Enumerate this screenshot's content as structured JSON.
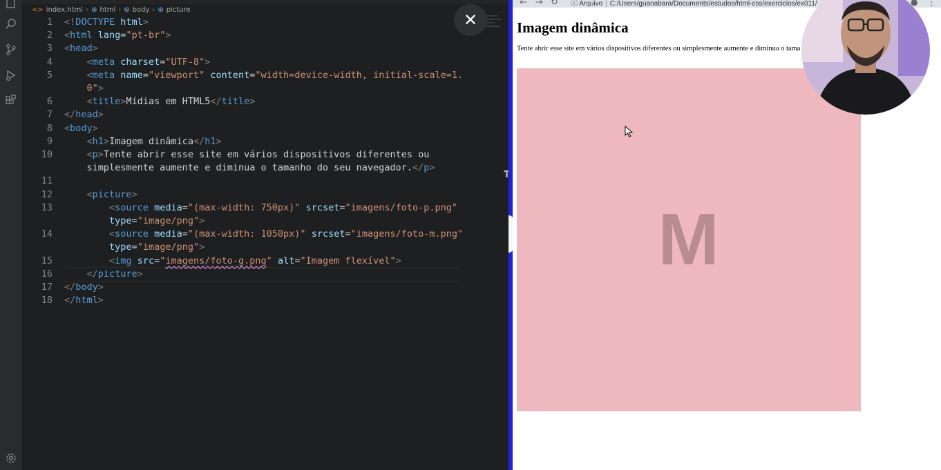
{
  "editor": {
    "breadcrumb": [
      "index.html",
      "html",
      "body",
      "picture"
    ],
    "lines": [
      {
        "n": "1",
        "parts": [
          [
            "br",
            "<!"
          ],
          [
            "tag",
            "DOCTYPE "
          ],
          [
            "at",
            "html"
          ],
          [
            "br",
            ">"
          ]
        ]
      },
      {
        "n": "2",
        "parts": [
          [
            "br",
            "<"
          ],
          [
            "tag",
            "html "
          ],
          [
            "at",
            "lang"
          ],
          [
            "txt",
            "="
          ],
          [
            "str",
            "\"pt-br\""
          ],
          [
            "br",
            ">"
          ]
        ]
      },
      {
        "n": "3",
        "parts": [
          [
            "br",
            "<"
          ],
          [
            "tag",
            "head"
          ],
          [
            "br",
            ">"
          ]
        ]
      },
      {
        "n": "4",
        "parts": [
          [
            "txt",
            "    "
          ],
          [
            "br",
            "<"
          ],
          [
            "tag",
            "meta "
          ],
          [
            "at",
            "charset"
          ],
          [
            "txt",
            "="
          ],
          [
            "str",
            "\"UTF-8\""
          ],
          [
            "br",
            ">"
          ]
        ]
      },
      {
        "n": "5",
        "parts": [
          [
            "txt",
            "    "
          ],
          [
            "br",
            "<"
          ],
          [
            "tag",
            "meta "
          ],
          [
            "at",
            "name"
          ],
          [
            "txt",
            "="
          ],
          [
            "str",
            "\"viewport\""
          ],
          [
            "txt",
            " "
          ],
          [
            "at",
            "content"
          ],
          [
            "txt",
            "="
          ],
          [
            "str",
            "\"width=device-width, initial-scale=1."
          ]
        ]
      },
      {
        "n": "",
        "parts": [
          [
            "txt",
            "    "
          ],
          [
            "str",
            "0\""
          ],
          [
            "br",
            ">"
          ]
        ]
      },
      {
        "n": "6",
        "parts": [
          [
            "txt",
            "    "
          ],
          [
            "br",
            "<"
          ],
          [
            "tag",
            "title"
          ],
          [
            "br",
            ">"
          ],
          [
            "txt",
            "Mídias em HTML5"
          ],
          [
            "br",
            "</"
          ],
          [
            "tag",
            "title"
          ],
          [
            "br",
            ">"
          ]
        ]
      },
      {
        "n": "7",
        "parts": [
          [
            "br",
            "</"
          ],
          [
            "tag",
            "head"
          ],
          [
            "br",
            ">"
          ]
        ]
      },
      {
        "n": "8",
        "parts": [
          [
            "br",
            "<"
          ],
          [
            "tag",
            "body"
          ],
          [
            "br",
            ">"
          ]
        ]
      },
      {
        "n": "9",
        "parts": [
          [
            "txt",
            "    "
          ],
          [
            "br",
            "<"
          ],
          [
            "tag",
            "h1"
          ],
          [
            "br",
            ">"
          ],
          [
            "txt",
            "Imagem dinâmica"
          ],
          [
            "br",
            "</"
          ],
          [
            "tag",
            "h1"
          ],
          [
            "br",
            ">"
          ]
        ]
      },
      {
        "n": "10",
        "parts": [
          [
            "txt",
            "    "
          ],
          [
            "br",
            "<"
          ],
          [
            "tag",
            "p"
          ],
          [
            "br",
            ">"
          ],
          [
            "txt",
            "Tente abrir esse site em vários dispositivos diferentes ou"
          ]
        ]
      },
      {
        "n": "",
        "parts": [
          [
            "txt",
            "    simplesmente aumente e diminua o tamanho do seu navegador."
          ],
          [
            "br",
            "</"
          ],
          [
            "tag",
            "p"
          ],
          [
            "br",
            ">"
          ]
        ]
      },
      {
        "n": "11",
        "parts": []
      },
      {
        "n": "12",
        "parts": [
          [
            "txt",
            "    "
          ],
          [
            "br",
            "<"
          ],
          [
            "tag",
            "picture"
          ],
          [
            "br",
            ">"
          ]
        ]
      },
      {
        "n": "13",
        "parts": [
          [
            "txt",
            "        "
          ],
          [
            "br",
            "<"
          ],
          [
            "tag",
            "source "
          ],
          [
            "at",
            "media"
          ],
          [
            "txt",
            "="
          ],
          [
            "str",
            "\"(max-width: 750px)\""
          ],
          [
            "txt",
            " "
          ],
          [
            "at",
            "srcset"
          ],
          [
            "txt",
            "="
          ],
          [
            "str",
            "\"imagens/foto-p.png\""
          ]
        ]
      },
      {
        "n": "",
        "parts": [
          [
            "txt",
            "        "
          ],
          [
            "at",
            "type"
          ],
          [
            "txt",
            "="
          ],
          [
            "str",
            "\"image/png\""
          ],
          [
            "br",
            ">"
          ]
        ]
      },
      {
        "n": "14",
        "parts": [
          [
            "txt",
            "        "
          ],
          [
            "br",
            "<"
          ],
          [
            "tag",
            "source "
          ],
          [
            "at",
            "media"
          ],
          [
            "txt",
            "="
          ],
          [
            "str",
            "\"(max-width: 1050px)\""
          ],
          [
            "txt",
            " "
          ],
          [
            "at",
            "srcset"
          ],
          [
            "txt",
            "="
          ],
          [
            "str",
            "\"imagens/foto-m.png\""
          ]
        ]
      },
      {
        "n": "",
        "parts": [
          [
            "txt",
            "        "
          ],
          [
            "at",
            "type"
          ],
          [
            "txt",
            "="
          ],
          [
            "str",
            "\"image/png\""
          ],
          [
            "br",
            ">"
          ]
        ]
      },
      {
        "n": "15",
        "parts": [
          [
            "txt",
            "        "
          ],
          [
            "br",
            "<"
          ],
          [
            "tag",
            "img "
          ],
          [
            "at",
            "src"
          ],
          [
            "txt",
            "="
          ],
          [
            "str",
            "\""
          ],
          [
            "stru",
            "imagens/foto-g.png"
          ],
          [
            "str",
            "\""
          ],
          [
            "txt",
            " "
          ],
          [
            "at",
            "alt"
          ],
          [
            "txt",
            "="
          ],
          [
            "str",
            "\"Imagem flexível\""
          ],
          [
            "br",
            ">"
          ]
        ]
      },
      {
        "n": "16",
        "parts": [
          [
            "txt",
            "    "
          ],
          [
            "br",
            "</"
          ],
          [
            "tag",
            "picture"
          ],
          [
            "br",
            ">"
          ]
        ]
      },
      {
        "n": "17",
        "parts": [
          [
            "br",
            "</"
          ],
          [
            "tag",
            "body"
          ],
          [
            "br",
            ">"
          ]
        ]
      },
      {
        "n": "18",
        "parts": [
          [
            "br",
            "</"
          ],
          [
            "tag",
            "html"
          ],
          [
            "br",
            ">"
          ]
        ]
      }
    ]
  },
  "close_symbol": "✕",
  "browser": {
    "url_label": "Arquivo",
    "url": "C:/Users/guanabara/Documents/estudos/html-css/exercicios/ex011/",
    "h1": "Imagem dinâmica",
    "paragraph": "Tente abrir esse site em vários dispositivos diferentes ou simplesmente aumente e diminua o tama",
    "image_letter": "M",
    "image_color": "#efb8bf"
  }
}
